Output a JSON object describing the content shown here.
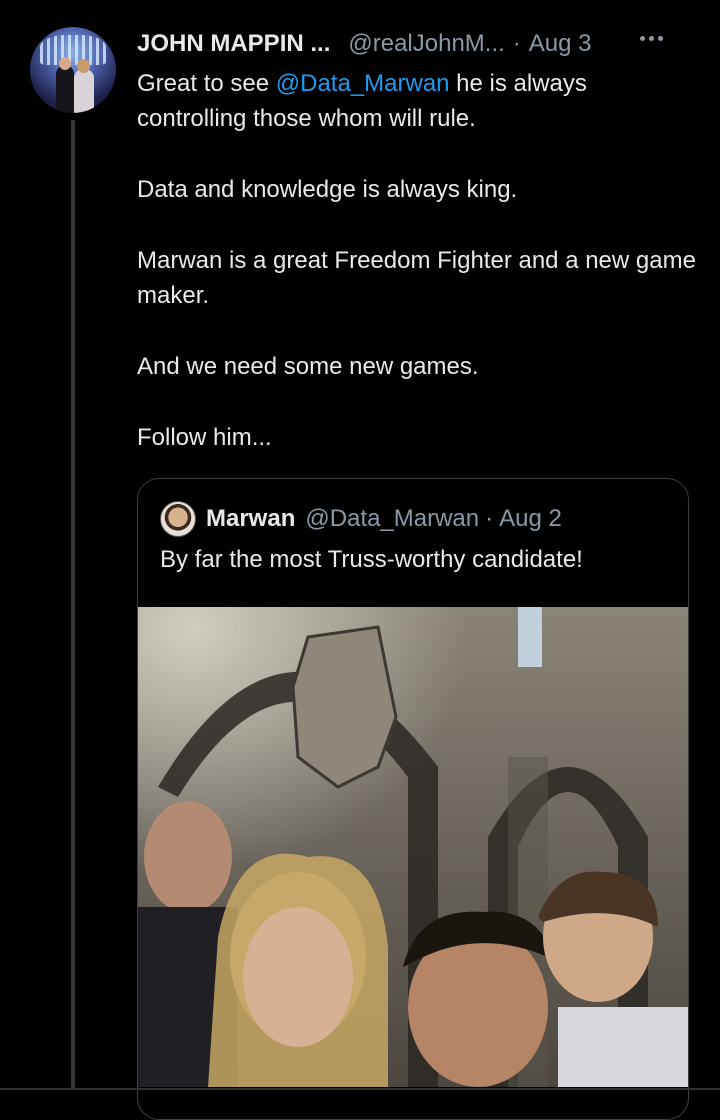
{
  "tweet": {
    "author_name": "JOHN MAPPIN ...",
    "author_handle": "@realJohnM...",
    "separator": "·",
    "date": "Aug 3",
    "body": {
      "line1_prefix": "Great to see ",
      "mention": "@Data_Marwan",
      "line1_suffix": " he is always controlling those whom will rule.",
      "para2": "Data and knowledge is always king.",
      "para3": "Marwan is a great Freedom Fighter and a new game maker.",
      "para4": "And we need some new games.",
      "para5": "Follow him..."
    }
  },
  "quoted_tweet": {
    "author_name": "Marwan",
    "author_handle": "@Data_Marwan",
    "separator": "·",
    "date": "Aug 2",
    "text": "By far the most Truss-worthy candidate!"
  },
  "icons": {
    "more": "more-horizontal-icon"
  },
  "colors": {
    "background": "#000000",
    "text": "#e7e9ea",
    "secondary": "#8b98a5",
    "link": "#1d9bf0",
    "border": "#3a3f44"
  }
}
